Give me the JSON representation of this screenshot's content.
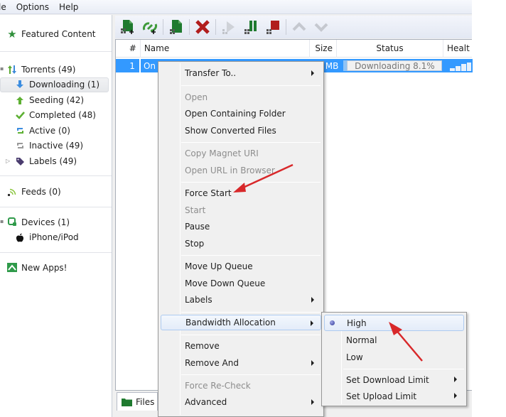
{
  "menubar": {
    "items": [
      "le",
      "Options",
      "Help"
    ]
  },
  "sidebar": {
    "featured": "Featured Content",
    "torrents": "Torrents (49)",
    "downloading": "Downloading (1)",
    "seeding": "Seeding (42)",
    "completed": "Completed (48)",
    "active": "Active (0)",
    "inactive": "Inactive (49)",
    "labels": "Labels (49)",
    "feeds": "Feeds (0)",
    "devices": "Devices (1)",
    "iphone": "iPhone/iPod",
    "new_apps": "New Apps!"
  },
  "toolbar": {
    "buttons": [
      "add-torrent",
      "add-url",
      "create-torrent",
      "remove",
      "start",
      "pause",
      "stop",
      "move-up",
      "move-down"
    ]
  },
  "table": {
    "columns": [
      "#",
      "Name",
      "Size",
      "Status",
      "Healt"
    ],
    "rows": [
      {
        "num": "1",
        "name": "On",
        "size": "MB",
        "status": "Downloading 8.1%",
        "progress": 0.081
      }
    ]
  },
  "bottom_tabs": {
    "files": "Files"
  },
  "context_menu": {
    "items": [
      {
        "label": "Transfer To..",
        "disabled": false,
        "submenu": true
      },
      {
        "label": "Open",
        "disabled": true,
        "submenu": false
      },
      {
        "label": "Open Containing Folder",
        "disabled": false,
        "submenu": false
      },
      {
        "label": "Show Converted Files",
        "disabled": false,
        "submenu": false
      },
      {
        "label": "Copy Magnet URI",
        "disabled": true,
        "submenu": false
      },
      {
        "label": "Open URL in Browser",
        "disabled": true,
        "submenu": false
      },
      {
        "label": "Force Start",
        "disabled": false,
        "submenu": false
      },
      {
        "label": "Start",
        "disabled": true,
        "submenu": false
      },
      {
        "label": "Pause",
        "disabled": false,
        "submenu": false
      },
      {
        "label": "Stop",
        "disabled": false,
        "submenu": false
      },
      {
        "label": "Move Up Queue",
        "disabled": false,
        "submenu": false
      },
      {
        "label": "Move Down Queue",
        "disabled": false,
        "submenu": false
      },
      {
        "label": "Labels",
        "disabled": false,
        "submenu": true
      },
      {
        "label": "Bandwidth Allocation",
        "disabled": false,
        "submenu": true,
        "highlighted": true
      },
      {
        "label": "Remove",
        "disabled": false,
        "submenu": false
      },
      {
        "label": "Remove And",
        "disabled": false,
        "submenu": true
      },
      {
        "label": "Force Re-Check",
        "disabled": true,
        "submenu": false
      },
      {
        "label": "Advanced",
        "disabled": false,
        "submenu": true
      }
    ]
  },
  "bandwidth_submenu": {
    "items": [
      {
        "label": "High",
        "selected": true,
        "submenu": false
      },
      {
        "label": "Normal",
        "selected": false,
        "submenu": false
      },
      {
        "label": "Low",
        "selected": false,
        "submenu": false
      },
      {
        "label": "Set Download Limit",
        "selected": false,
        "submenu": true
      },
      {
        "label": "Set Upload Limit",
        "selected": false,
        "submenu": true
      }
    ]
  },
  "colors": {
    "selection_blue": "#3399ff",
    "annotation_red": "#d8282a",
    "accent_green": "#2f8f3a"
  }
}
